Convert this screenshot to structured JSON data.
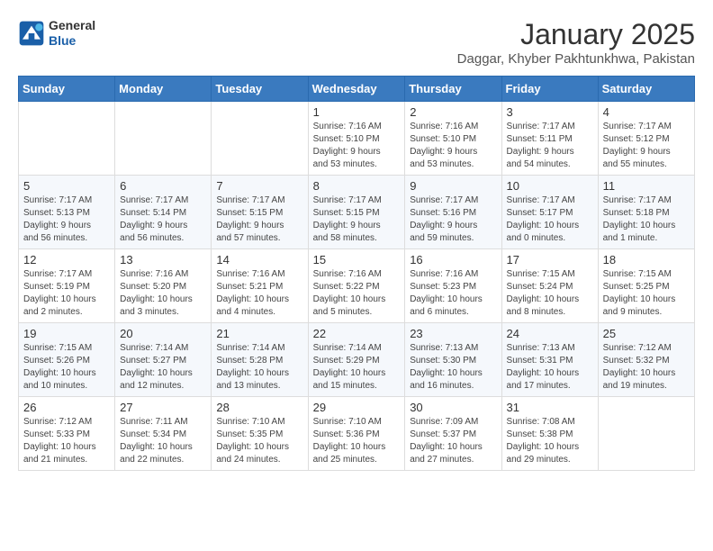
{
  "logo": {
    "general": "General",
    "blue": "Blue"
  },
  "header": {
    "title": "January 2025",
    "subtitle": "Daggar, Khyber Pakhtunkhwa, Pakistan"
  },
  "weekdays": [
    "Sunday",
    "Monday",
    "Tuesday",
    "Wednesday",
    "Thursday",
    "Friday",
    "Saturday"
  ],
  "weeks": [
    [
      {
        "day": "",
        "info": ""
      },
      {
        "day": "",
        "info": ""
      },
      {
        "day": "",
        "info": ""
      },
      {
        "day": "1",
        "info": "Sunrise: 7:16 AM\nSunset: 5:10 PM\nDaylight: 9 hours\nand 53 minutes."
      },
      {
        "day": "2",
        "info": "Sunrise: 7:16 AM\nSunset: 5:10 PM\nDaylight: 9 hours\nand 53 minutes."
      },
      {
        "day": "3",
        "info": "Sunrise: 7:17 AM\nSunset: 5:11 PM\nDaylight: 9 hours\nand 54 minutes."
      },
      {
        "day": "4",
        "info": "Sunrise: 7:17 AM\nSunset: 5:12 PM\nDaylight: 9 hours\nand 55 minutes."
      }
    ],
    [
      {
        "day": "5",
        "info": "Sunrise: 7:17 AM\nSunset: 5:13 PM\nDaylight: 9 hours\nand 56 minutes."
      },
      {
        "day": "6",
        "info": "Sunrise: 7:17 AM\nSunset: 5:14 PM\nDaylight: 9 hours\nand 56 minutes."
      },
      {
        "day": "7",
        "info": "Sunrise: 7:17 AM\nSunset: 5:15 PM\nDaylight: 9 hours\nand 57 minutes."
      },
      {
        "day": "8",
        "info": "Sunrise: 7:17 AM\nSunset: 5:15 PM\nDaylight: 9 hours\nand 58 minutes."
      },
      {
        "day": "9",
        "info": "Sunrise: 7:17 AM\nSunset: 5:16 PM\nDaylight: 9 hours\nand 59 minutes."
      },
      {
        "day": "10",
        "info": "Sunrise: 7:17 AM\nSunset: 5:17 PM\nDaylight: 10 hours\nand 0 minutes."
      },
      {
        "day": "11",
        "info": "Sunrise: 7:17 AM\nSunset: 5:18 PM\nDaylight: 10 hours\nand 1 minute."
      }
    ],
    [
      {
        "day": "12",
        "info": "Sunrise: 7:17 AM\nSunset: 5:19 PM\nDaylight: 10 hours\nand 2 minutes."
      },
      {
        "day": "13",
        "info": "Sunrise: 7:16 AM\nSunset: 5:20 PM\nDaylight: 10 hours\nand 3 minutes."
      },
      {
        "day": "14",
        "info": "Sunrise: 7:16 AM\nSunset: 5:21 PM\nDaylight: 10 hours\nand 4 minutes."
      },
      {
        "day": "15",
        "info": "Sunrise: 7:16 AM\nSunset: 5:22 PM\nDaylight: 10 hours\nand 5 minutes."
      },
      {
        "day": "16",
        "info": "Sunrise: 7:16 AM\nSunset: 5:23 PM\nDaylight: 10 hours\nand 6 minutes."
      },
      {
        "day": "17",
        "info": "Sunrise: 7:15 AM\nSunset: 5:24 PM\nDaylight: 10 hours\nand 8 minutes."
      },
      {
        "day": "18",
        "info": "Sunrise: 7:15 AM\nSunset: 5:25 PM\nDaylight: 10 hours\nand 9 minutes."
      }
    ],
    [
      {
        "day": "19",
        "info": "Sunrise: 7:15 AM\nSunset: 5:26 PM\nDaylight: 10 hours\nand 10 minutes."
      },
      {
        "day": "20",
        "info": "Sunrise: 7:14 AM\nSunset: 5:27 PM\nDaylight: 10 hours\nand 12 minutes."
      },
      {
        "day": "21",
        "info": "Sunrise: 7:14 AM\nSunset: 5:28 PM\nDaylight: 10 hours\nand 13 minutes."
      },
      {
        "day": "22",
        "info": "Sunrise: 7:14 AM\nSunset: 5:29 PM\nDaylight: 10 hours\nand 15 minutes."
      },
      {
        "day": "23",
        "info": "Sunrise: 7:13 AM\nSunset: 5:30 PM\nDaylight: 10 hours\nand 16 minutes."
      },
      {
        "day": "24",
        "info": "Sunrise: 7:13 AM\nSunset: 5:31 PM\nDaylight: 10 hours\nand 17 minutes."
      },
      {
        "day": "25",
        "info": "Sunrise: 7:12 AM\nSunset: 5:32 PM\nDaylight: 10 hours\nand 19 minutes."
      }
    ],
    [
      {
        "day": "26",
        "info": "Sunrise: 7:12 AM\nSunset: 5:33 PM\nDaylight: 10 hours\nand 21 minutes."
      },
      {
        "day": "27",
        "info": "Sunrise: 7:11 AM\nSunset: 5:34 PM\nDaylight: 10 hours\nand 22 minutes."
      },
      {
        "day": "28",
        "info": "Sunrise: 7:10 AM\nSunset: 5:35 PM\nDaylight: 10 hours\nand 24 minutes."
      },
      {
        "day": "29",
        "info": "Sunrise: 7:10 AM\nSunset: 5:36 PM\nDaylight: 10 hours\nand 25 minutes."
      },
      {
        "day": "30",
        "info": "Sunrise: 7:09 AM\nSunset: 5:37 PM\nDaylight: 10 hours\nand 27 minutes."
      },
      {
        "day": "31",
        "info": "Sunrise: 7:08 AM\nSunset: 5:38 PM\nDaylight: 10 hours\nand 29 minutes."
      },
      {
        "day": "",
        "info": ""
      }
    ]
  ]
}
